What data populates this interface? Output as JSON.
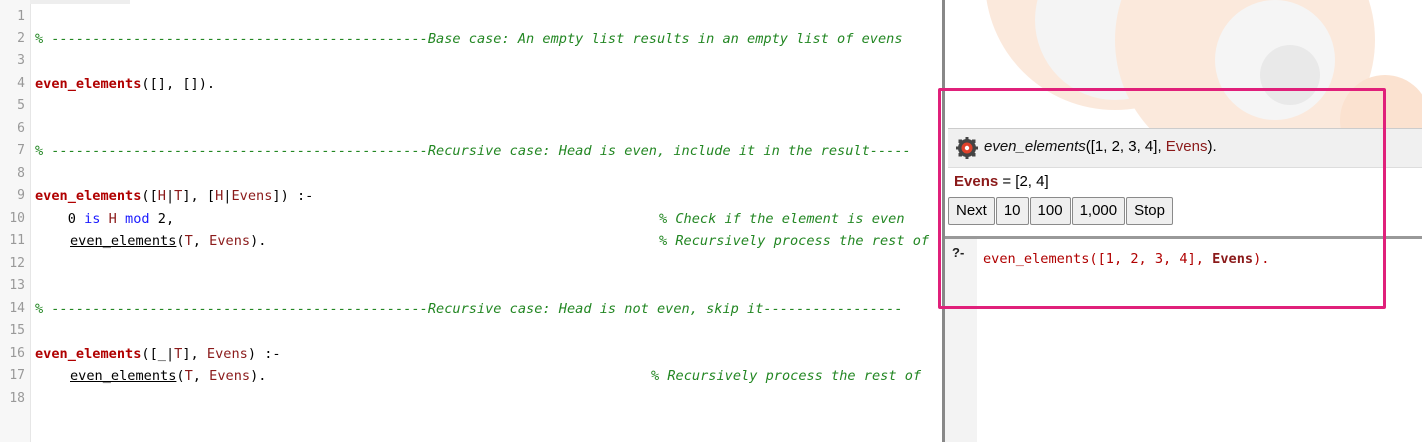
{
  "editor": {
    "line_numbers": [
      "1",
      "2",
      "3",
      "4",
      "5",
      "6",
      "7",
      "8",
      "9",
      "10",
      "11",
      "12",
      "13",
      "14",
      "15",
      "16",
      "17",
      "18"
    ],
    "lines": {
      "l2": "% ----------------------------------------------Base case: An empty list results in an empty list of evens",
      "l4_pred": "even_elements",
      "l4_rest": "([], []).",
      "l7": "% ----------------------------------------------Recursive case: Head is even, include it in the result-----",
      "l9_pred": "even_elements",
      "l9_a": "([",
      "l9_h": "H",
      "l9_b": "|",
      "l9_t": "T",
      "l9_c": "], [",
      "l9_h2": "H",
      "l9_d": "|",
      "l9_e": "Evens",
      "l9_f": "]) :-",
      "l10_a": "    0 ",
      "l10_is": "is",
      "l10_h": " H ",
      "l10_mod": "mod",
      "l10_b": " 2,",
      "l10_comment": "% Check if the element is even",
      "l11_call": "even_elements",
      "l11_a": "(",
      "l11_t": "T",
      "l11_b": ", ",
      "l11_e": "Evens",
      "l11_c": ").",
      "l11_comment": "% Recursively process the rest of",
      "l14": "% ----------------------------------------------Recursive case: Head is not even, skip it-----------------",
      "l16_pred": "even_elements",
      "l16_a": "([_|",
      "l16_t": "T",
      "l16_b": "], ",
      "l16_e": "Evens",
      "l16_c": ") :-",
      "l17_call": "even_elements",
      "l17_a": "(",
      "l17_t": "T",
      "l17_b": ", ",
      "l17_e": "Evens",
      "l17_c": ").",
      "l17_comment": "% Recursively process the rest of"
    }
  },
  "answer": {
    "query_pred": "even_elements",
    "query_args": "([1, 2, 3, 4], ",
    "query_var": "Evens",
    "query_end": ").",
    "result_var": "Evens",
    "result_value": " = [2, 4]",
    "buttons": {
      "next": "Next",
      "ten": "10",
      "hundred": "100",
      "thousand": "1,000",
      "stop": "Stop"
    }
  },
  "query_editor": {
    "prompt": "?-",
    "input_pred": "even_elements([1, 2, 3, 4], ",
    "input_var": "Evens",
    "input_end": ")."
  },
  "colors": {
    "highlight": "#e0207a",
    "comment": "#238723",
    "predicate": "#b00000",
    "variable": "#8b1a1a"
  }
}
